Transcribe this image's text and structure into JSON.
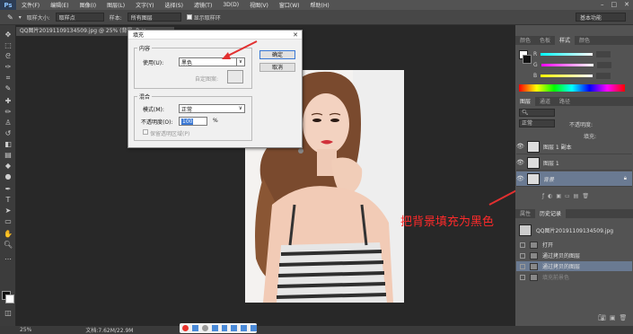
{
  "menubar": {
    "logo": "Ps",
    "items": [
      "文件(F)",
      "编辑(E)",
      "图像(I)",
      "图层(L)",
      "文字(Y)",
      "选择(S)",
      "滤镜(T)",
      "3D(D)",
      "视图(V)",
      "窗口(W)",
      "帮助(H)"
    ],
    "min": "–",
    "max": "□",
    "close": "✕"
  },
  "options": {
    "sample_size_label": "取样大小:",
    "sample_size_value": "取样点",
    "sample_label": "样本:",
    "sample_value": "所有图层",
    "show_ring_label": "显示取样环",
    "workspace": "基本功能"
  },
  "document": {
    "tab": "QQ图片20191109134509.jpg @ 25% (背景, R"
  },
  "status": {
    "zoom": "25%",
    "doc": "文档:7.62M/22.9M"
  },
  "dialog": {
    "title": "填充",
    "content_group": "内容",
    "use_label": "使用(U):",
    "use_value": "黑色",
    "pattern_label": "自定图案:",
    "blend_group": "混合",
    "mode_label": "模式(M):",
    "mode_value": "正常",
    "opacity_label": "不透明度(O):",
    "opacity_value": "100",
    "opacity_unit": "%",
    "preserve_label": "保留透明区域(P)",
    "ok": "确定",
    "cancel": "取消"
  },
  "annotation": "把背景填充为黑色",
  "color_panel": {
    "tabs": [
      "颜色",
      "色板",
      "样式",
      "颜色"
    ],
    "r_label": "R",
    "g_label": "G",
    "b_label": "B"
  },
  "layers_panel": {
    "tabs": [
      "图层",
      "通道",
      "路径"
    ],
    "kind": "正常",
    "opacity_label": "不透明度:",
    "fill_label": "填充:",
    "layers": [
      "图层 1 副本",
      "图层 1",
      "背景"
    ]
  },
  "history_panel": {
    "tabs": [
      "属性",
      "历史记录"
    ],
    "snapshot": "QQ图片20191109134509.jpg",
    "items": [
      "打开",
      "通过拷贝的图层",
      "通过拷贝的图层",
      "填充前景色"
    ]
  },
  "colors": {
    "accent": "#3a78d4",
    "arrow": "#e23030",
    "annotation": "#ff2a2a"
  }
}
